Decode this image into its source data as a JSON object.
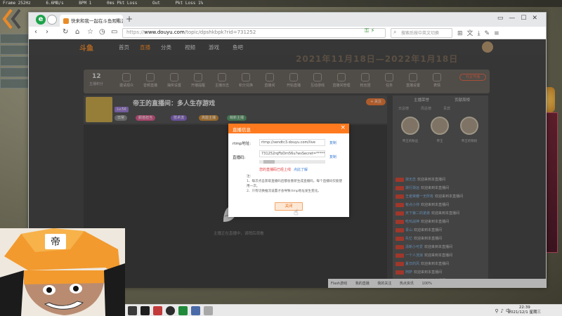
{
  "game_hud": {
    "top_text": [
      "Frame 252Hz",
      "6.6MB/s",
      "BPM 1",
      "0ms Pkt Loss",
      "Out",
      "Pkt Loss 1%"
    ]
  },
  "browser": {
    "tab_title": "快来和我一起在斗鱼观看游戏!",
    "new_tab": "+",
    "url": {
      "protocol": "https://",
      "domain": "www.douyu.com",
      "path": "/topic/dpshkbpk?rid=731252"
    },
    "search_placeholder": "搜索后按中英文切换",
    "window_controls": [
      "▭",
      "—",
      "☐",
      "✕"
    ]
  },
  "site": {
    "logo": "斗鱼",
    "nav": [
      "首页",
      "直播",
      "分类",
      "视频",
      "游戏",
      "鱼吧"
    ],
    "banner_date": "2021年11月18日—2022年1月18日",
    "count": "12",
    "count_label": "主播积分",
    "features": [
      "邀请观众",
      "音频直播",
      "抽奖设置",
      "开播提醒",
      "主播日志",
      "积分兑换",
      "直播间",
      "开始直播",
      "互动游戏",
      "直播间管理",
      "粉丝团",
      "任务",
      "直播设置",
      "表情"
    ],
    "rank_button": "代言开播",
    "stream": {
      "title": "帝王的直播间：多人生存游戏",
      "level": "Lv.56",
      "tags": [
        "日常",
        "颜值担当",
        "技术流",
        "高能主播",
        "萌新主播"
      ],
      "follow": "+ 关注"
    },
    "player_message": "主播正在直播中，请稍后观看",
    "sidebar": {
      "tabs": [
        "主播荣誉",
        "贡献周榜"
      ],
      "subtabs": [
        "日总榜",
        "周总榜",
        "贵宾"
      ],
      "fans": [
        "帝王的粉丝",
        "帝王",
        "帝王的铁粉"
      ],
      "chat": [
        {
          "user": "渐无念",
          "msg": "欢迎来到本直播间"
        },
        {
          "user": "渐行渐远",
          "msg": "欢迎来到本直播间"
        },
        {
          "user": "王者荣耀一无所有",
          "msg": "欢迎来到本直播间"
        },
        {
          "user": "有点小帅",
          "msg": "欢迎来到本直播间"
        },
        {
          "user": "天下第二的弟弟",
          "msg": "欢迎来到本直播间"
        },
        {
          "user": "吃鸡战神",
          "msg": "欢迎来到本直播间"
        },
        {
          "user": "青山",
          "msg": "欢迎来到本直播间"
        },
        {
          "user": "失忆",
          "msg": "欢迎来到本直播间"
        },
        {
          "user": "清新小可爱",
          "msg": "欢迎来到本直播间"
        },
        {
          "user": "一个人流浪",
          "msg": "欢迎来到本直播间"
        },
        {
          "user": "夏日的风",
          "msg": "欢迎来到本直播间"
        },
        {
          "user": "阿萨",
          "msg": "欢迎来到本直播间"
        },
        {
          "user": "小胖子",
          "msg": "欢迎来到本直播间"
        },
        {
          "user": "Coldfeeling",
          "msg": "欢迎来到本直播间"
        },
        {
          "user": "无名氏",
          "msg": "欢迎来到本直播间"
        }
      ]
    },
    "bottom_bar": [
      "Flash游戏",
      "我的直播",
      "我的关注",
      "热点资讯",
      "100%"
    ]
  },
  "dialog": {
    "title": "直播信息",
    "rtmp_label": "rtmp地址:",
    "rtmp_value": "rtmp://sendtc3.douyu.com/live",
    "key_label": "直播码:",
    "key_value": "731252rqFbDm56u?wsSecret=********",
    "copy": "复制",
    "warning": "您的直播码已经上线",
    "warning_link": "点此了解",
    "notes": [
      "注：",
      "1、每次点击获取直播码后都会重新生成直播码，每个直播码仅能使用一次。",
      "2、只有切换推流设置才会导致rtmp地址发生变化。"
    ],
    "close_button": "关闭"
  },
  "taskbar": {
    "time": "22:39",
    "date": "2021/12/1 星期三"
  },
  "zoom": "100%",
  "colors": {
    "douyu_orange": "#ff7a1e",
    "link_blue": "#3a7bd5",
    "warning_red": "#e4393c"
  }
}
